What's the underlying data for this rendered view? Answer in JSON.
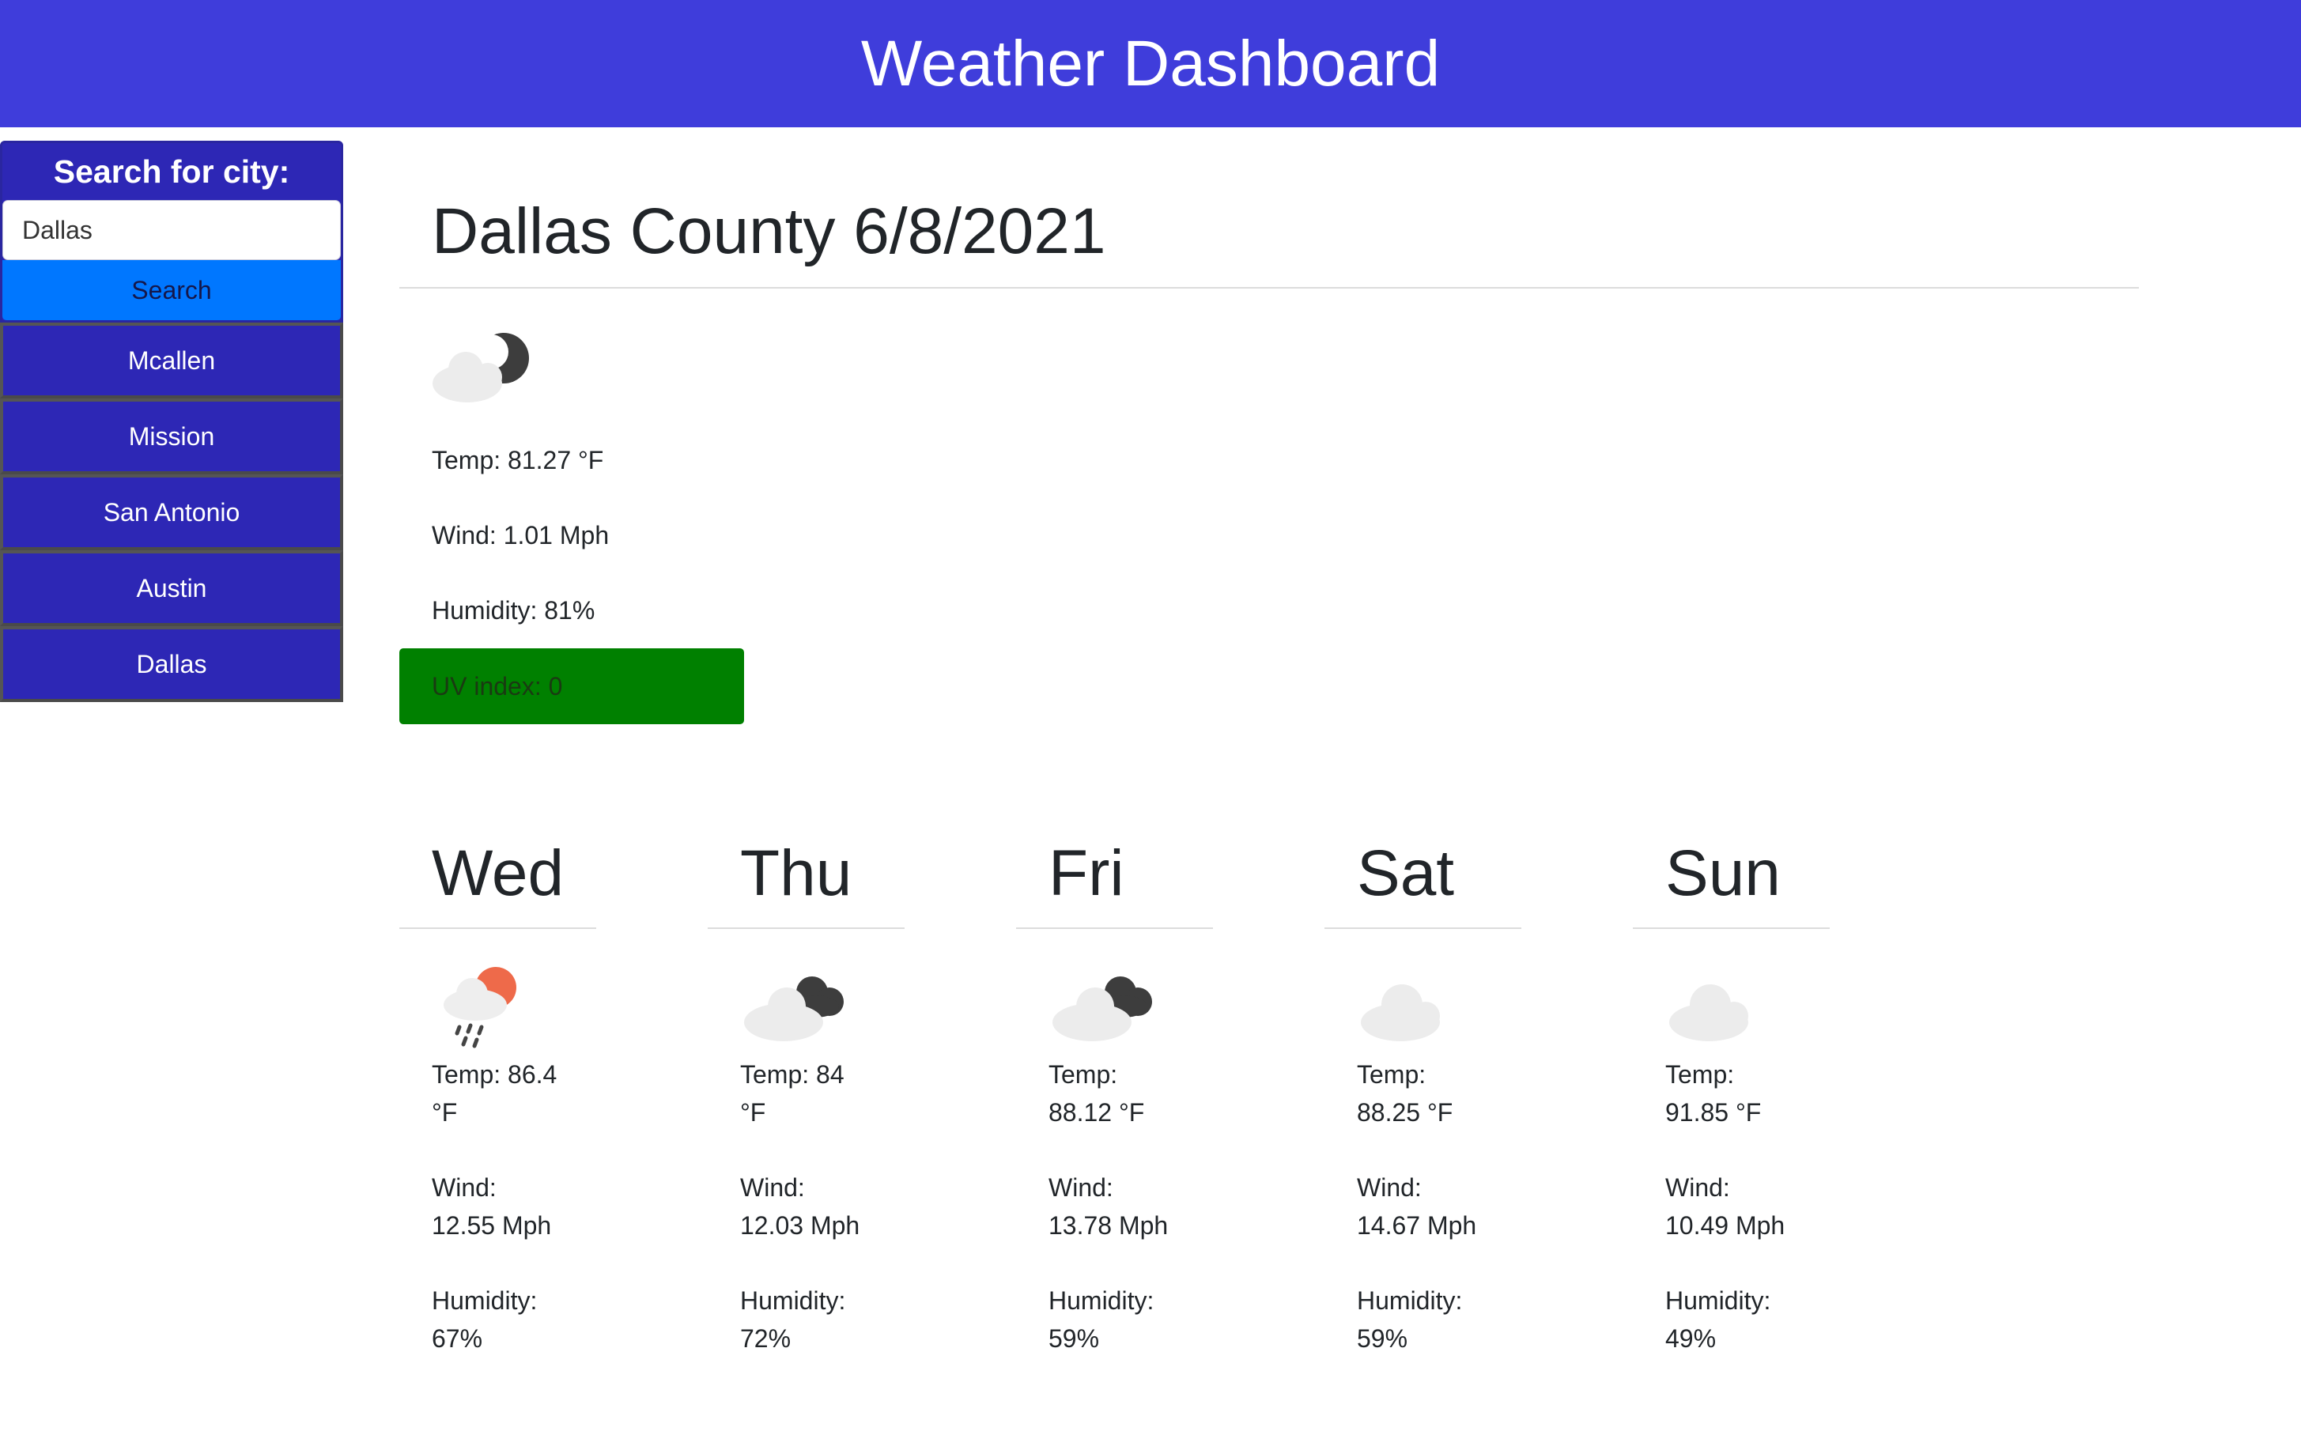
{
  "header": {
    "title": "Weather Dashboard"
  },
  "sidebar": {
    "search_title": "Search for city:",
    "search_value": "Dallas",
    "search_button": "Search",
    "history": [
      "Mcallen",
      "Mission",
      "San Antonio",
      "Austin",
      "Dallas"
    ]
  },
  "today": {
    "title": "Dallas County 6/8/2021",
    "icon": "night-cloud-icon",
    "temp": "Temp: 81.27 °F",
    "wind": "Wind: 1.01 Mph",
    "humidity": "Humidity: 81%",
    "uv": "UV index: 0",
    "uv_color": "#008000"
  },
  "forecast": [
    {
      "day": "Wed",
      "icon": "rain-sun-icon",
      "temp_label": "Temp: 86.4",
      "temp_unit": "°F",
      "wind_label": "Wind:",
      "wind": "12.55 Mph",
      "hum_label": "Humidity:",
      "humidity": "67%"
    },
    {
      "day": "Thu",
      "icon": "dark-clouds-icon",
      "temp_label": "Temp: 84",
      "temp_unit": "°F",
      "wind_label": "Wind:",
      "wind": "12.03 Mph",
      "hum_label": "Humidity:",
      "humidity": "72%"
    },
    {
      "day": "Fri",
      "icon": "dark-clouds-icon",
      "temp_label": "Temp:",
      "temp_unit": "88.12 °F",
      "wind_label": "Wind:",
      "wind": "13.78 Mph",
      "hum_label": "Humidity:",
      "humidity": "59%"
    },
    {
      "day": "Sat",
      "icon": "cloud-icon",
      "temp_label": "Temp:",
      "temp_unit": "88.25 °F",
      "wind_label": "Wind:",
      "wind": "14.67 Mph",
      "hum_label": "Humidity:",
      "humidity": "59%"
    },
    {
      "day": "Sun",
      "icon": "cloud-icon",
      "temp_label": "Temp:",
      "temp_unit": "91.85 °F",
      "wind_label": "Wind:",
      "wind": "10.49 Mph",
      "hum_label": "Humidity:",
      "humidity": "49%"
    }
  ],
  "colors": {
    "header": "#3f3ddb",
    "sidebar": "#2d27b5",
    "search_button": "#0077ff",
    "uv_low": "#008000"
  }
}
